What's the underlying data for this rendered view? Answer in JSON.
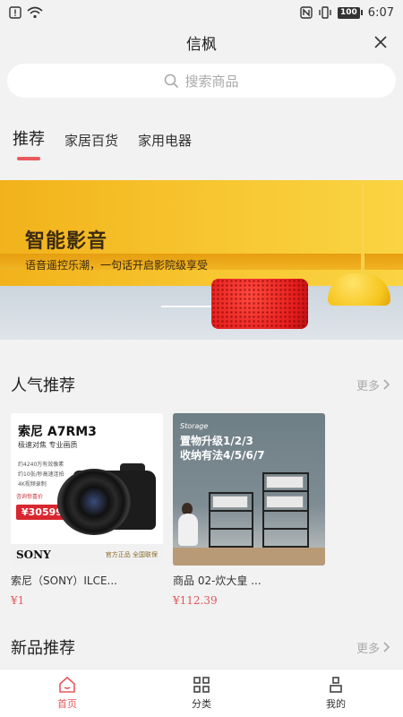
{
  "status_bar": {
    "time": "6:07",
    "battery": "100"
  },
  "header": {
    "title": "信枫"
  },
  "search": {
    "placeholder": "搜索商品"
  },
  "tabs": [
    {
      "label": "推荐",
      "active": true
    },
    {
      "label": "家居百货",
      "active": false
    },
    {
      "label": "家用电器",
      "active": false
    }
  ],
  "banner": {
    "title": "智能影音",
    "subtitle": "语音遥控乐潮，一句话开启影院级享受"
  },
  "popular": {
    "title": "人气推荐",
    "more": "更多",
    "products": [
      {
        "name": "索尼（SONY）ILCE...",
        "price": "¥1",
        "image": {
          "title": "索尼 A7RM3",
          "slogan": "极速对焦 专业画质",
          "features": [
            "约4240万有效像素",
            "约10张/秒高速连拍",
            "4K视频录制"
          ],
          "tag": "咨询惊喜价",
          "price": "¥30599",
          "brand": "SONY",
          "badge": "官方正品 全国联保"
        }
      },
      {
        "name": "商品 02-炊大皇 ...",
        "price": "¥112.39",
        "image": {
          "title": "Storage",
          "line1": "置物升级1/2/3",
          "line2": "收纳有法4/5/6/7"
        }
      }
    ]
  },
  "new_arrivals": {
    "title": "新品推荐",
    "more": "更多"
  },
  "bottom_nav": [
    {
      "label": "首页",
      "icon": "home-icon",
      "active": true
    },
    {
      "label": "分类",
      "icon": "category-icon",
      "active": false
    },
    {
      "label": "我的",
      "icon": "profile-icon",
      "active": false
    }
  ],
  "colors": {
    "accent": "#e9595e",
    "price": "#e15759",
    "background": "#f2f2f2"
  }
}
